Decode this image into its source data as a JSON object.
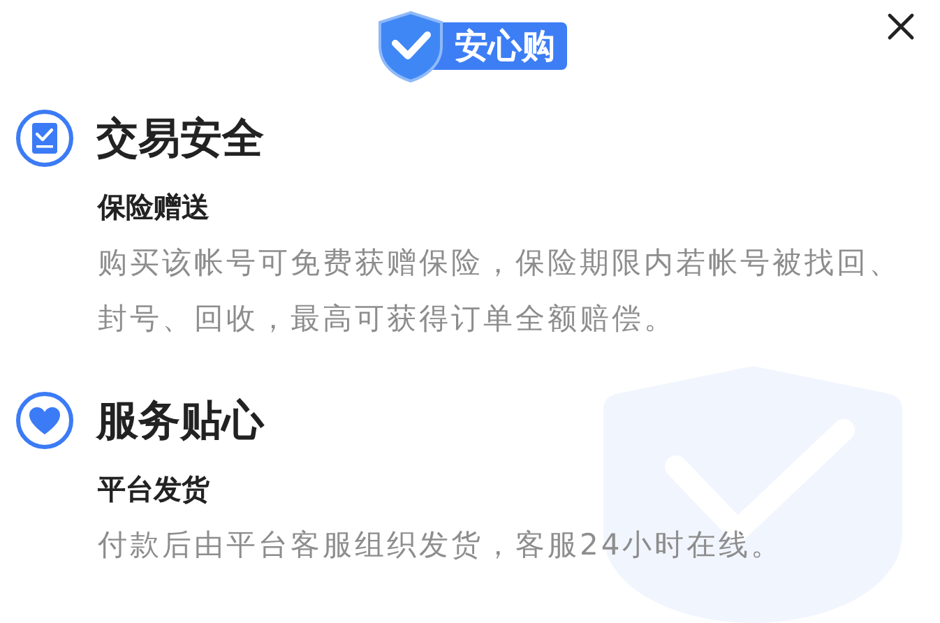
{
  "badge": {
    "label": "安心购"
  },
  "sections": [
    {
      "kind": "checklist",
      "title": "交易安全",
      "subtitle": "保险赠送",
      "body": "购买该帐号可免费获赠保险，保险期限内若帐号被找回、封号、回收，最高可获得订单全额赔偿。"
    },
    {
      "kind": "heart",
      "title": "服务贴心",
      "subtitle": "平台发货",
      "body": "付款后由平台客服组织发货，客服24小时在线。"
    }
  ]
}
